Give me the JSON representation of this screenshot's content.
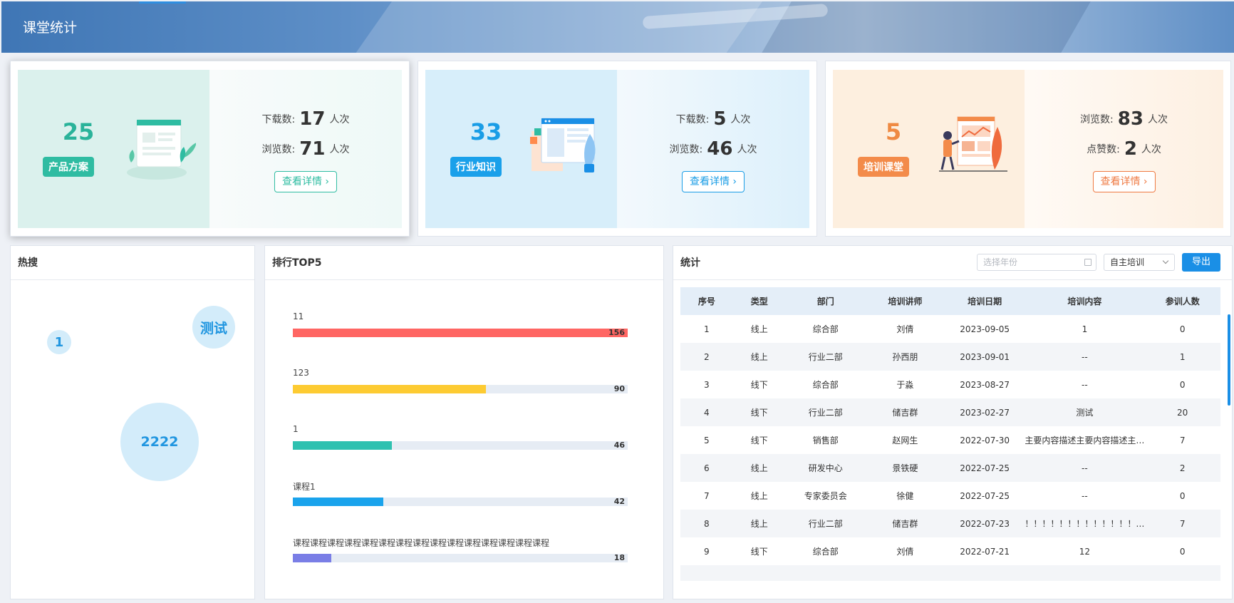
{
  "header": {
    "title": "课堂统计"
  },
  "cards": [
    {
      "count": "25",
      "tag": "产品方案",
      "row1_label": "下载数:",
      "row1_value": "17",
      "row1_unit": "人次",
      "row2_label": "浏览数:",
      "row2_value": "71",
      "row2_unit": "人次",
      "button": "查看详情",
      "icon": "document-plant-icon"
    },
    {
      "count": "33",
      "tag": "行业知识",
      "row1_label": "下载数:",
      "row1_value": "5",
      "row1_unit": "人次",
      "row2_label": "浏览数:",
      "row2_value": "46",
      "row2_unit": "人次",
      "button": "查看详情",
      "icon": "window-plant-icon"
    },
    {
      "count": "5",
      "tag": "培训课堂",
      "row1_label": "浏览数:",
      "row1_value": "83",
      "row1_unit": "人次",
      "row2_label": "点赞数:",
      "row2_value": "2",
      "row2_unit": "人次",
      "button": "查看详情",
      "icon": "presentation-person-icon"
    }
  ],
  "hot": {
    "title": "热搜",
    "bubbles": [
      "1",
      "测试",
      "2222"
    ]
  },
  "rank": {
    "title": "排行TOP5",
    "items": [
      {
        "label": "11",
        "value": 156,
        "color": "#ff6663"
      },
      {
        "label": "123",
        "value": 90,
        "color": "#fdcb32"
      },
      {
        "label": "1",
        "value": 46,
        "color": "#2fc1b0"
      },
      {
        "label": "课程1",
        "value": 42,
        "color": "#1aa3ec"
      },
      {
        "label": "课程课程课程课程课程课程课程课程课程课程课程课程课程课程课程",
        "value": 18,
        "color": "#7a7ee6"
      }
    ],
    "max": 156
  },
  "stats": {
    "title": "统计",
    "year_placeholder": "选择年份",
    "type_select": "自主培训",
    "export": "导出",
    "columns": [
      "序号",
      "类型",
      "部门",
      "培训讲师",
      "培训日期",
      "培训内容",
      "参训人数"
    ],
    "rows": [
      [
        "1",
        "线上",
        "综合部",
        "刘倩",
        "2023-09-05",
        "1",
        "0"
      ],
      [
        "2",
        "线上",
        "行业二部",
        "孙西朋",
        "2023-09-01",
        "--",
        "1"
      ],
      [
        "3",
        "线下",
        "综合部",
        "于淼",
        "2023-08-27",
        "--",
        "0"
      ],
      [
        "4",
        "线下",
        "行业二部",
        "储吉群",
        "2023-02-27",
        "测试",
        "20"
      ],
      [
        "5",
        "线下",
        "销售部",
        "赵网生",
        "2022-07-30",
        "主要内容描述主要内容描述主…",
        "7"
      ],
      [
        "6",
        "线上",
        "研发中心",
        "景铁硬",
        "2022-07-25",
        "--",
        "2"
      ],
      [
        "7",
        "线上",
        "专家委员会",
        "徐健",
        "2022-07-25",
        "--",
        "0"
      ],
      [
        "8",
        "线上",
        "行业二部",
        "储吉群",
        "2022-07-23",
        "！！！！！！！！！！！！！…",
        "7"
      ],
      [
        "9",
        "线下",
        "综合部",
        "刘倩",
        "2022-07-21",
        "12",
        "0"
      ],
      [
        "",
        "",
        "",
        "",
        "",
        "",
        ""
      ]
    ]
  }
}
